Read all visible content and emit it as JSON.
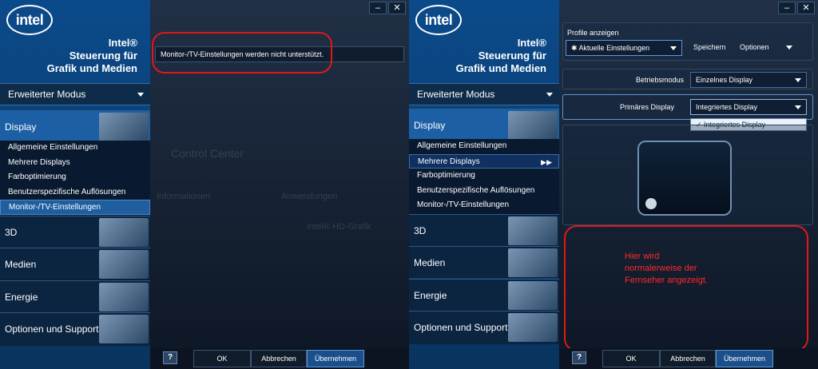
{
  "brand": {
    "logo": "intel",
    "app_title": "Intel®\nSteuerung für\nGrafik und Medien"
  },
  "window": {
    "minimize": "–",
    "close": "✕"
  },
  "sidebar": {
    "mode_label": "Erweiterter Modus",
    "categories": [
      {
        "label": "Display"
      },
      {
        "label": "3D"
      },
      {
        "label": "Medien"
      },
      {
        "label": "Energie"
      },
      {
        "label": "Optionen und Support"
      }
    ],
    "display_subitems": [
      {
        "label": "Allgemeine Einstellungen"
      },
      {
        "label": "Mehrere Displays"
      },
      {
        "label": "Farboptimierung"
      },
      {
        "label": "Benutzerspezifische Auflösungen"
      },
      {
        "label": "Monitor-/TV-Einstellungen"
      }
    ]
  },
  "left": {
    "message": "Monitor-/TV-Einstellungen werden nicht unterstützt.",
    "ghost": {
      "control_center": "Control Center",
      "info": "Informationen",
      "apps": "Anwendungen",
      "hd": "Intel® HD-Grafik"
    }
  },
  "right": {
    "profiles_label": "Profile anzeigen",
    "profile_value": "✱ Aktuelle Einstellungen",
    "save_label": "Speichern",
    "options_label": "Optionen",
    "mode_label": "Betriebsmodus",
    "mode_value": "Einzelnes Display",
    "primary_label": "Primäres Display",
    "primary_value": "Integriertes Display",
    "popup_option": "Integriertes Display",
    "note": "Hier wird\nnormalerweise der\nFernseher angezeigt."
  },
  "bottom": {
    "help": "?",
    "ok": "OK",
    "cancel": "Abbrechen",
    "apply": "Übernehmen"
  },
  "colors": {
    "accent": "#1c5fa5",
    "annotation": "#e01818"
  }
}
